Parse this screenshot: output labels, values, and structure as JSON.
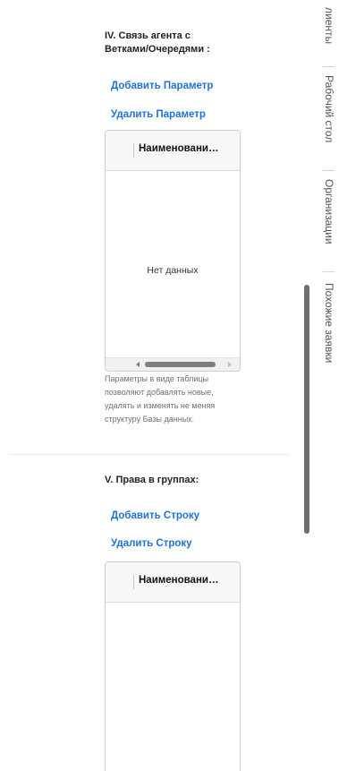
{
  "section4": {
    "title": "IV. Связь агента с\nВетками/Очередями :",
    "add_link": "Добавить Параметр",
    "remove_link": "Удалить Параметр",
    "grid": {
      "column_header": "Наименовани…",
      "empty_text": "Нет данных"
    },
    "helper_text": "Параметры в виде таблицы позволяют добавлять новые, удалять и изменять не меняя структуру Базы данных."
  },
  "section5": {
    "title": "V. Права в группах:",
    "add_link": "Добавить Строку",
    "remove_link": "Удалить Строку",
    "grid": {
      "column_header": "Наименовани…"
    }
  },
  "right_rail": {
    "tabs": [
      {
        "label": "лиенты"
      },
      {
        "label": "Рабочий стол"
      },
      {
        "label": "Организации"
      },
      {
        "label": "Похожие заявки"
      }
    ]
  }
}
